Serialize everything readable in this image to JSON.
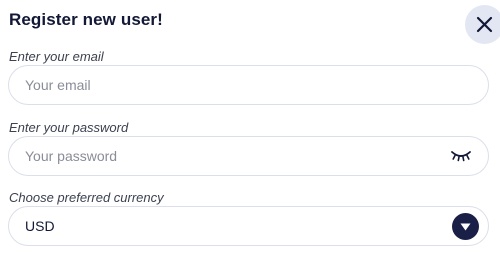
{
  "dialog": {
    "title": "Register new user!",
    "close_icon": "close-icon"
  },
  "email": {
    "label": "Enter your email",
    "placeholder": "Your email"
  },
  "password": {
    "label": "Enter your password",
    "placeholder": "Your password",
    "toggle_icon": "eye-closed-icon"
  },
  "currency": {
    "label": "Choose preferred currency",
    "selected": "USD",
    "dropdown_icon": "chevron-down-icon"
  },
  "colors": {
    "title": "#121836",
    "accent": "#1a1f47",
    "close_bg": "#e3e6f3",
    "border": "#dcdfe9"
  }
}
